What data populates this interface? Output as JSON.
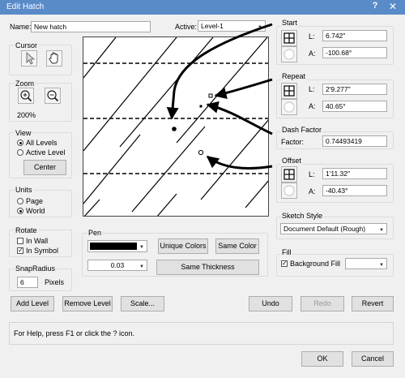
{
  "window": {
    "title": "Edit Hatch",
    "help_glyph": "?",
    "close_glyph": "✕"
  },
  "name_field": {
    "label": "Name:",
    "value": "New hatch"
  },
  "active_field": {
    "label": "Active:",
    "value": "Level-1"
  },
  "cursor": {
    "label": "Cursor"
  },
  "zoom": {
    "label": "Zoom",
    "value": "200%"
  },
  "view": {
    "label": "View",
    "options": [
      "All Levels",
      "Active Level"
    ],
    "selected": "All Levels",
    "center_label": "Center"
  },
  "units": {
    "label": "Units",
    "options": [
      "Page",
      "World"
    ],
    "selected": "World"
  },
  "rotate": {
    "label": "Rotate",
    "in_wall": "In Wall",
    "in_wall_checked": false,
    "in_symbol": "In Symbol",
    "in_symbol_checked": true
  },
  "snap_radius": {
    "label": "SnapRadius",
    "value": "6",
    "unit": "Pixels"
  },
  "pen": {
    "label": "Pen",
    "color": "#000000",
    "thickness": "0.03",
    "unique_colors": "Unique Colors",
    "same_color": "Same Color",
    "same_thickness": "Same Thickness"
  },
  "start": {
    "label": "Start",
    "L_label": "L:",
    "L_value": "6.742\"",
    "A_label": "A:",
    "A_value": "-100.68°"
  },
  "repeat": {
    "label": "Repeat",
    "L_label": "L:",
    "L_value": "2'9.277\"",
    "A_label": "A:",
    "A_value": "40.65°"
  },
  "dash_factor": {
    "label": "Dash Factor",
    "field_label": "Factor:",
    "value": "0.74493419"
  },
  "offset": {
    "label": "Offset",
    "L_label": "L:",
    "L_value": "1'11.32\"",
    "A_label": "A:",
    "A_value": "-40.43°"
  },
  "sketch_style": {
    "label": "Sketch Style",
    "value": "Document Default (Rough)"
  },
  "fill": {
    "label": "Fill",
    "background_fill": "Background Fill",
    "checked": true
  },
  "buttons": {
    "add_level": "Add Level",
    "remove_level": "Remove Level",
    "scale": "Scale...",
    "undo": "Undo",
    "redo": "Redo",
    "revert": "Revert",
    "ok": "OK",
    "cancel": "Cancel"
  },
  "status": {
    "text": "For Help, press F1 or click the ? icon."
  },
  "colors": {
    "titlebar": "#5a8bc9",
    "window_bg": "#f0f0f0"
  },
  "icons": [
    "arrow-cursor-icon",
    "hand-cursor-icon",
    "zoom-in-icon",
    "zoom-out-icon",
    "grid-icon",
    "circle-icon"
  ]
}
